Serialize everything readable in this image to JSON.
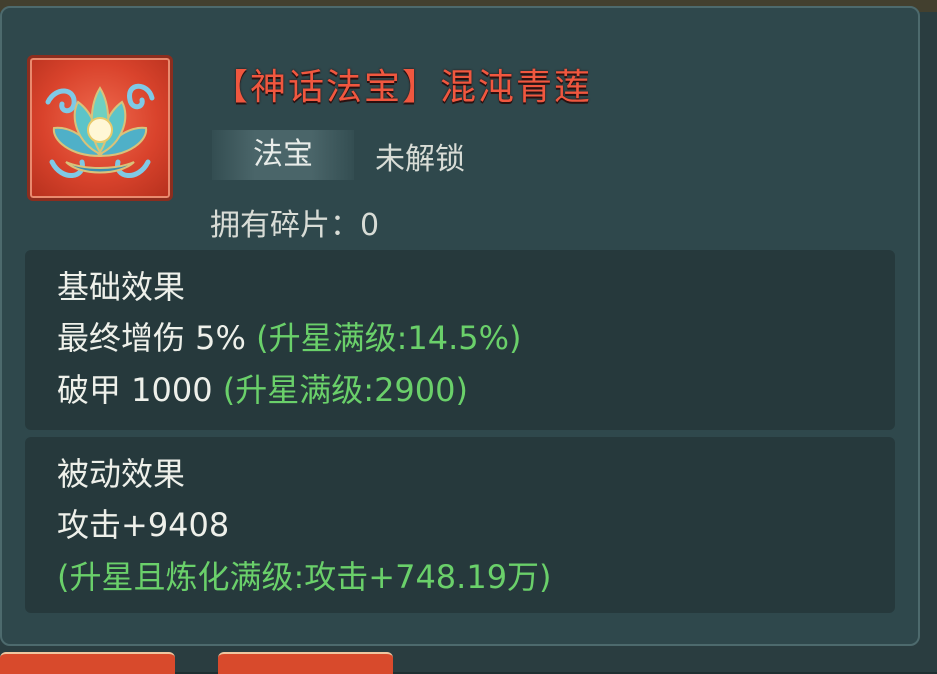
{
  "item": {
    "title": "【神话法宝】混沌青莲",
    "icon": "lotus-icon",
    "type_tag": "法宝",
    "status": "未解锁",
    "shards_label": "拥有碎片：",
    "shards_count": "0"
  },
  "basic_effects": {
    "heading": "基础效果",
    "rows": [
      {
        "name": "最终增伤 5%",
        "max": "(升星满级:14.5%)"
      },
      {
        "name": "破甲 1000",
        "max": "(升星满级:2900)"
      }
    ]
  },
  "passive_effects": {
    "heading": "被动效果",
    "value": "攻击+9408",
    "max": "(升星且炼化满级:攻击+748.19万)"
  },
  "colors": {
    "title": "#f0573f",
    "max_value": "#6ad06a",
    "panel": "#2f484c",
    "box": "#26393c"
  }
}
